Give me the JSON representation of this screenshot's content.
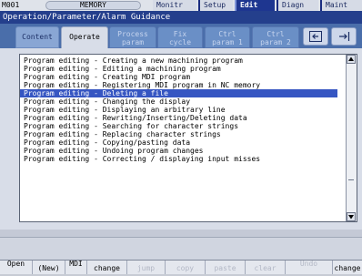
{
  "status": {
    "program_no": "M001",
    "mode": "MEMORY"
  },
  "menu": {
    "monitr": "Monitr",
    "setup": "Setup",
    "edit": "Edit",
    "diagn": "Diagn",
    "maint": "Maint"
  },
  "title": "Operation/Parameter/Alarm Guidance",
  "tabs": {
    "content": "Content",
    "operate": "Operate",
    "process_1": "Process",
    "process_2": "param",
    "fix_1": "Fix",
    "fix_2": "cycle",
    "ctrl1_1": "Ctrl",
    "ctrl1_2": "param 1",
    "ctrl2_1": "Ctrl",
    "ctrl2_2": "param 2"
  },
  "list": {
    "selected_index": 4,
    "items": [
      "Program editing - Creating a new machining program",
      "Program editing - Editing a machining program",
      "Program editing - Creating MDI program",
      "Program editing - Registering MDI program in NC memory",
      "Program editing - Deleting a file",
      "Program editing - Changing the display",
      "Program editing - Displaying an arbitrary line",
      "Program editing - Rewriting/Inserting/Deleting data",
      "Program editing - Searching for character strings",
      "Program editing - Replacing character strings",
      "Program editing - Copying/pasting data",
      "Program editing - Undoing program changes",
      "Program editing - Correcting / displaying input misses"
    ]
  },
  "softkeys": {
    "open": "Open",
    "new": "(New)",
    "mdi": "MDI",
    "change": "change",
    "jump": "jump",
    "copy": "copy",
    "paste": "paste",
    "clear": "clear",
    "undo": "Undo",
    "mode": "change"
  }
}
